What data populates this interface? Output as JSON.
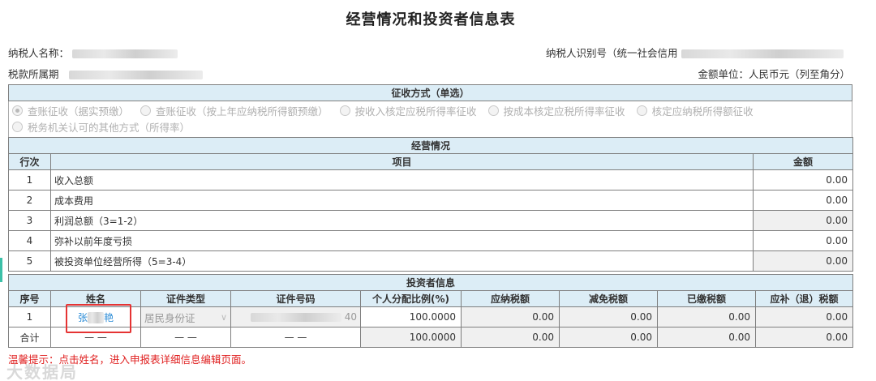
{
  "page": {
    "title": "经营情况和投资者信息表",
    "taxpayer_name_label": "纳税人名称：",
    "taxpayer_id_label": "纳税人识别号（统一社会信用",
    "tax_period_label": "税款所属期",
    "currency_note": "金额单位：人民币元（列至角分）"
  },
  "collection_method": {
    "section_title": "征收方式（单选）",
    "options": [
      {
        "label": "查账征收（据实预缴）",
        "selected": true
      },
      {
        "label": "查账征收（按上年应纳税所得额预缴）",
        "selected": false
      },
      {
        "label": "核定应税所得率征收",
        "selected": false
      },
      {
        "label": "核定应纳税所得额征收",
        "selected": false
      },
      {
        "label": "按收入核定应税所得率征收",
        "selected": false
      },
      {
        "label": "按成本核定应税所得率征收",
        "selected": false
      },
      {
        "label": "税务机关认可的其他方式（所得率）",
        "selected": false
      }
    ]
  },
  "operations": {
    "section_title": "经营情况",
    "headers": {
      "line": "行次",
      "item": "项目",
      "amount": "金额"
    },
    "rows": [
      {
        "line": "1",
        "item": "收入总额",
        "amount": "0.00",
        "readonly": false
      },
      {
        "line": "2",
        "item": "成本费用",
        "amount": "0.00",
        "readonly": false
      },
      {
        "line": "3",
        "item": "利润总额（3=1-2）",
        "amount": "0.00",
        "readonly": true
      },
      {
        "line": "4",
        "item": "弥补以前年度亏损",
        "amount": "0.00",
        "readonly": false
      },
      {
        "line": "5",
        "item": "被投资单位经营所得（5=3-4）",
        "amount": "0.00",
        "readonly": true
      }
    ]
  },
  "investors": {
    "section_title": "投资者信息",
    "headers": [
      "序号",
      "姓名",
      "证件类型",
      "证件号码",
      "个人分配比例(%)",
      "应纳税额",
      "减免税额",
      "已缴税额",
      "应补（退）税额"
    ],
    "row": {
      "seq": "1",
      "name_first": "张",
      "name_last": "艳",
      "id_type": "居民身份证",
      "id_suffix": "40",
      "ratio": "100.0000",
      "tax_payable": "0.00",
      "tax_relief": "0.00",
      "tax_paid": "0.00",
      "tax_due": "0.00"
    },
    "total": {
      "label": "合计",
      "name": "— —",
      "id_type": "— —",
      "id_number": "— —",
      "ratio": "100.0000",
      "tax_payable": "0.00",
      "tax_relief": "0.00",
      "tax_paid": "0.00",
      "tax_due": "0.00"
    }
  },
  "hint": "温馨提示：点击姓名，进入申报表详细信息编辑页面。",
  "watermark": "大数据局"
}
